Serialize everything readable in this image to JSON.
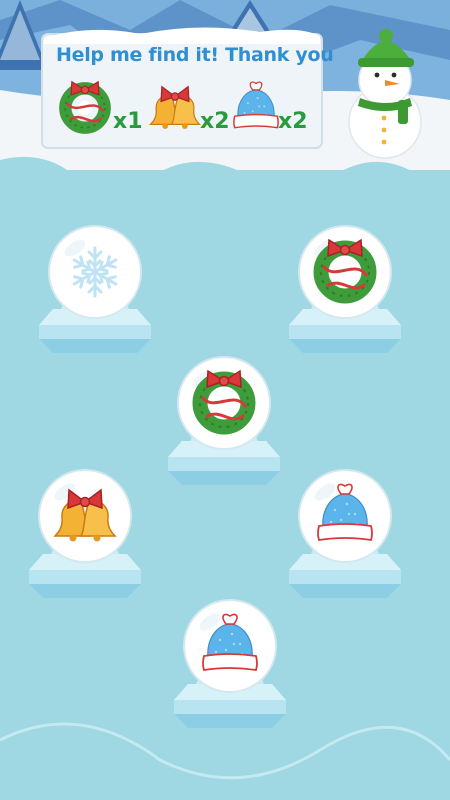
{
  "task": {
    "title": "Help me find it! Thank you",
    "items": [
      {
        "icon": "wreath-icon",
        "count": "x1"
      },
      {
        "icon": "bells-icon",
        "count": "x2"
      },
      {
        "icon": "knit-hat-icon",
        "count": "x2"
      }
    ]
  },
  "colors": {
    "ice": "#9fd7e2",
    "snow": "#f3f6f8",
    "title_text": "#2f8fd0",
    "count_text": "#2a9a3e",
    "wreath_green": "#3f9c3a",
    "ribbon_red": "#d9383a",
    "bell_gold": "#f3b234",
    "hat_blue": "#5bb4ea"
  },
  "board": {
    "globes": [
      {
        "name": "globe-1",
        "content": "snowflake-icon",
        "revealed": false
      },
      {
        "name": "globe-2",
        "content": "wreath-icon",
        "revealed": true
      },
      {
        "name": "globe-3",
        "content": "wreath-icon",
        "revealed": true
      },
      {
        "name": "globe-4",
        "content": "bells-icon",
        "revealed": true
      },
      {
        "name": "globe-5",
        "content": "knit-hat-icon",
        "revealed": true
      },
      {
        "name": "globe-6",
        "content": "knit-hat-icon",
        "revealed": true
      }
    ]
  }
}
